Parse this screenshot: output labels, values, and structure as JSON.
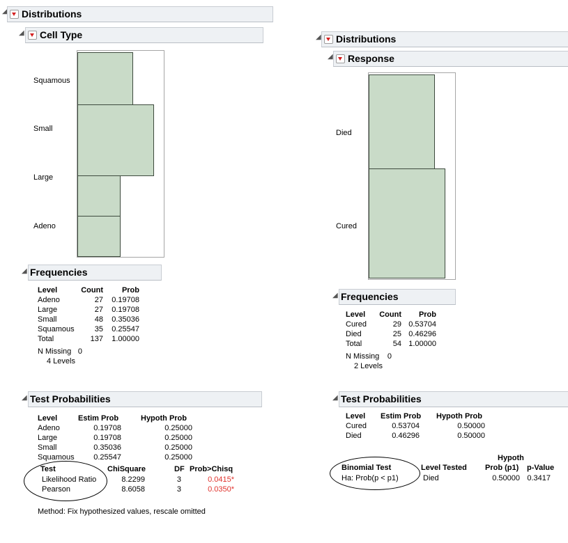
{
  "left": {
    "distributions_title": "Distributions",
    "variable_title": "Cell Type",
    "chart_data": {
      "type": "bar",
      "categories": [
        "Squamous",
        "Small",
        "Large",
        "Adeno"
      ],
      "values": [
        35,
        48,
        27,
        27
      ]
    },
    "frequencies": {
      "title": "Frequencies",
      "headers": [
        "Level",
        "Count",
        "Prob"
      ],
      "rows": [
        [
          "Adeno",
          "27",
          "0.19708"
        ],
        [
          "Large",
          "27",
          "0.19708"
        ],
        [
          "Small",
          "48",
          "0.35036"
        ],
        [
          "Squamous",
          "35",
          "0.25547"
        ],
        [
          "Total",
          "137",
          "1.00000"
        ]
      ],
      "n_missing_label": "N Missing",
      "n_missing_value": "0",
      "levels_text": "4 Levels"
    },
    "test_prob": {
      "title": "Test Probabilities",
      "headers": [
        "Level",
        "Estim Prob",
        "Hypoth Prob"
      ],
      "rows": [
        [
          "Adeno",
          "0.19708",
          "0.25000"
        ],
        [
          "Large",
          "0.19708",
          "0.25000"
        ],
        [
          "Small",
          "0.35036",
          "0.25000"
        ],
        [
          "Squamous",
          "0.25547",
          "0.25000"
        ]
      ],
      "test_headers": [
        "Test",
        "ChiSquare",
        "DF",
        "Prob>Chisq"
      ],
      "test_rows": [
        [
          "Likelihood Ratio",
          "8.2299",
          "3",
          "0.0415*"
        ],
        [
          "Pearson",
          "8.6058",
          "3",
          "0.0350*"
        ]
      ],
      "method": "Method: Fix hypothesized values, rescale omitted"
    }
  },
  "right": {
    "distributions_title": "Distributions",
    "variable_title": "Response",
    "chart_data": {
      "type": "bar",
      "categories": [
        "Died",
        "Cured"
      ],
      "values": [
        25,
        29
      ]
    },
    "frequencies": {
      "title": "Frequencies",
      "headers": [
        "Level",
        "Count",
        "Prob"
      ],
      "rows": [
        [
          "Cured",
          "29",
          "0.53704"
        ],
        [
          "Died",
          "25",
          "0.46296"
        ],
        [
          "Total",
          "54",
          "1.00000"
        ]
      ],
      "n_missing_label": "N Missing",
      "n_missing_value": "0",
      "levels_text": "2 Levels"
    },
    "test_prob": {
      "title": "Test Probabilities",
      "headers": [
        "Level",
        "Estim Prob",
        "Hypoth Prob"
      ],
      "rows": [
        [
          "Cured",
          "0.53704",
          "0.50000"
        ],
        [
          "Died",
          "0.46296",
          "0.50000"
        ]
      ],
      "binom_header_top": "Hypoth",
      "binom_headers": [
        "Binomial Test",
        "Level Tested",
        "Prob (p1)",
        "p-Value"
      ],
      "binom_row": [
        "Ha: Prob(p < p1)",
        "Died",
        "0.50000",
        "0.3417"
      ]
    }
  }
}
